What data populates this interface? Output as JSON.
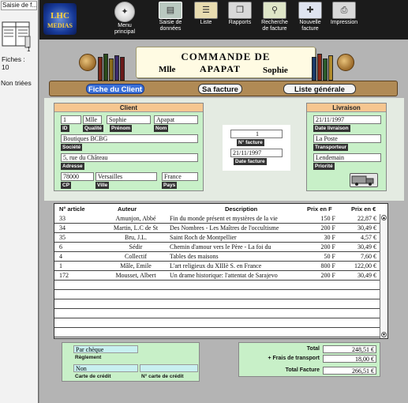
{
  "left_panel": {
    "title": "Saisie de f...",
    "count_label": "Fiches :",
    "count_value": "10",
    "count_side": "1",
    "sort_label": "Non triées"
  },
  "toolbar": {
    "logo_line1": "LHC",
    "logo_line2": "MEDIAS",
    "buttons": [
      {
        "label": "Menu\nprincipal"
      },
      {
        "label": "Saisie de\ndonnées"
      },
      {
        "label": "Liste"
      },
      {
        "label": "Rapports"
      },
      {
        "label": "Recherche\nde facture"
      },
      {
        "label": "Nouvelle\nfacture"
      },
      {
        "label": "Impression"
      }
    ]
  },
  "header": {
    "title": "COMMANDE DE",
    "civility": "Mlle",
    "last_name": "APAPAT",
    "first_name": "Sophie"
  },
  "tabs": [
    {
      "label": "Fiche du Client"
    },
    {
      "label": "Sa facture"
    },
    {
      "label": "Liste générale"
    }
  ],
  "client": {
    "title": "Client",
    "id": "1",
    "qualite": "Mlle",
    "prenom": "Sophie",
    "nom": "Apapat",
    "labels": {
      "id": "ID",
      "qualite": "Qualité",
      "prenom": "Prénom",
      "nom": "Nom",
      "societe": "Société",
      "adresse": "Adresse",
      "cp": "CP",
      "ville": "Ville",
      "pays": "Pays"
    },
    "societe": "Boutiques BCBG",
    "adresse": "5, rue du Château",
    "cp": "78000",
    "ville": "Versailles",
    "pays": "France"
  },
  "facture": {
    "numero": "1",
    "numero_label": "N° facture",
    "date": "21/11/1997",
    "date_label": "Date facture"
  },
  "livraison": {
    "title": "Livraison",
    "date": "21/11/1997",
    "date_label": "Date livraison",
    "transporteur": "La Poste",
    "transporteur_label": "Transporteur",
    "priorite": "Lendemain",
    "priorite_label": "Priorité"
  },
  "table": {
    "headers": [
      "N° article",
      "Auteur",
      "Description",
      "Prix en F",
      "Prix en €"
    ],
    "rows": [
      [
        "33",
        "Amunjon, Abbé",
        "Fin du monde présent et mystères de la vie",
        "150 F",
        "22,87 €"
      ],
      [
        "34",
        "Martin, L.C de St",
        "Des Nombres - Les Maîtres de l'occultisme",
        "200 F",
        "30,49 €"
      ],
      [
        "35",
        "Bru, J.L.",
        "Saint Roch de Montpellier",
        "30 F",
        "4,57 €"
      ],
      [
        "6",
        "Sédir",
        "Chemin d'amour vers le Père - La foi du",
        "200 F",
        "30,49 €"
      ],
      [
        "4",
        "Collectif",
        "Tables des maisons",
        "50 F",
        "7,60 €"
      ],
      [
        "1",
        "Mâle, Emile",
        "L'art religieux du XIIIè S. en France",
        "800 F",
        "122,00 €"
      ],
      [
        "172",
        "Mousset, Albert",
        "Un drame historique: l'attentat de Sarajevo",
        "200 F",
        "30,49 €"
      ]
    ]
  },
  "payment": {
    "reglement_value": "Par chèque",
    "reglement_label": "Règlement",
    "carte_value": "Non",
    "carte_label": "Carte de crédit",
    "carte_num_label": "N° carte de crédit"
  },
  "totals": {
    "total_label": "Total",
    "total_value": "248,51 €",
    "frais_label": "+ Frais de transport",
    "frais_value": "18,00 €",
    "total_facture_label": "Total Facture",
    "total_facture_value": "266,51 €"
  }
}
